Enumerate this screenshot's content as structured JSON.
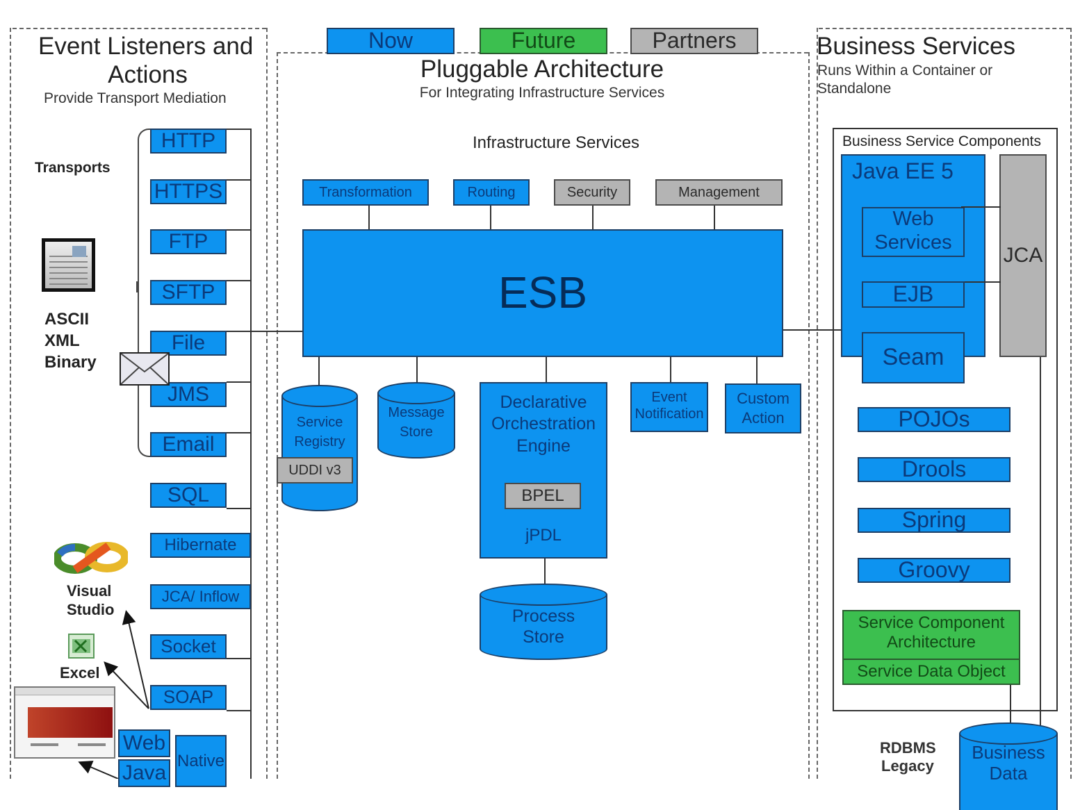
{
  "legend": {
    "now": "Now",
    "future": "Future",
    "partners": "Partners",
    "colors": {
      "now": "#0d93f0",
      "future": "#3cbf4f",
      "partners": "#b4b4b4"
    }
  },
  "left_panel": {
    "title_line1": "Event Listeners and",
    "title_line2": "Actions",
    "subtitle": "Provide Transport Mediation",
    "transports_label": "Transports",
    "formats": [
      "ASCII",
      "XML",
      "Binary"
    ],
    "transports": [
      "HTTP",
      "HTTPS",
      "FTP",
      "SFTP",
      "File",
      "JMS",
      "Email",
      "SQL",
      "Hibernate",
      "JCA/ Inflow",
      "Socket",
      "SOAP"
    ],
    "clients": {
      "visual_studio_line1": "Visual",
      "visual_studio_line2": "Studio",
      "excel": "Excel"
    },
    "web": "Web",
    "java": "Java",
    "native": "Native"
  },
  "center_panel": {
    "title": "Pluggable Architecture",
    "subtitle": "For Integrating Infrastructure Services",
    "infra_label": "Infrastructure Services",
    "infra_services": [
      "Transformation",
      "Routing",
      "Security",
      "Management"
    ],
    "esb": "ESB",
    "service_registry_line1": "Service",
    "service_registry_line2": "Registry",
    "uddi": "UDDI v3",
    "message_store_line1": "Message",
    "message_store_line2": "Store",
    "orchestration_line1": "Declarative",
    "orchestration_line2": "Orchestration",
    "orchestration_line3": "Engine",
    "bpel": "BPEL",
    "jpdl": "jPDL",
    "process_store_line1": "Process",
    "process_store_line2": "Store",
    "event_notification_line1": "Event",
    "event_notification_line2": "Notification",
    "custom_action_line1": "Custom",
    "custom_action_line2": "Action"
  },
  "right_panel": {
    "title": "Business Services",
    "subtitle_line1": "Runs Within a Container or",
    "subtitle_line2": "Standalone",
    "components_label": "Business Service Components",
    "java_ee": "Java EE 5",
    "web_services_line1": "Web",
    "web_services_line2": "Services",
    "ejb": "EJB",
    "seam": "Seam",
    "jca": "JCA",
    "frameworks": [
      "POJOs",
      "Drools",
      "Spring",
      "Groovy"
    ],
    "sca_line1": "Service Component",
    "sca_line2": "Architecture",
    "sdo": "Service Data Object",
    "rdbms_line1": "RDBMS",
    "rdbms_line2": "Legacy",
    "business_data_line1": "Business",
    "business_data_line2": "Data"
  }
}
